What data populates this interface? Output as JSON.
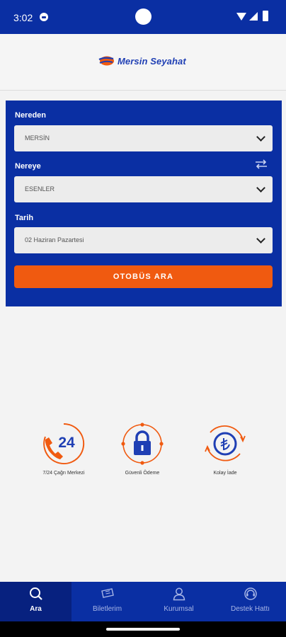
{
  "status_bar": {
    "time": "3:02"
  },
  "header": {
    "logo_text": "Mersin Seyahat"
  },
  "search_form": {
    "from_label": "Nereden",
    "from_value": "MERSİN",
    "to_label": "Nereye",
    "to_value": "ESENLER",
    "date_label": "Tarih",
    "date_value": "02 Haziran Pazartesi",
    "search_button": "OTOBÜS ARA"
  },
  "features": [
    {
      "label": "7/24 Çağrı Merkezi",
      "icon": "phone-24-icon",
      "icon_text": "24"
    },
    {
      "label": "Güvenli Ödeme",
      "icon": "padlock-icon"
    },
    {
      "label": "Kolay İade",
      "icon": "lira-refund-icon"
    }
  ],
  "bottom_nav": [
    {
      "label": "Ara",
      "icon": "search-icon",
      "active": true
    },
    {
      "label": "Biletlerim",
      "icon": "ticket-icon",
      "active": false
    },
    {
      "label": "Kurumsal",
      "icon": "user-icon",
      "active": false
    },
    {
      "label": "Destek Hattı",
      "icon": "support-icon",
      "active": false
    }
  ],
  "colors": {
    "brand_blue": "#0a2fa3",
    "accent_orange": "#f05a10",
    "background": "#f3f3f3"
  }
}
